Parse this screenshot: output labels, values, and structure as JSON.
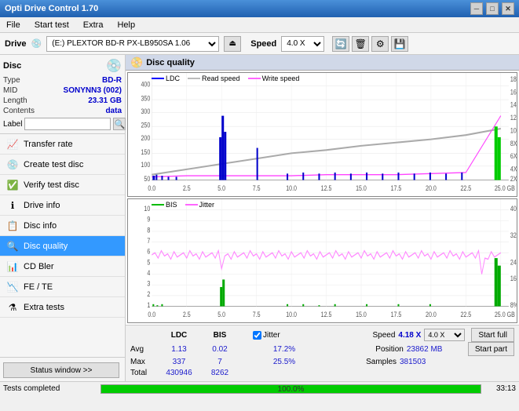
{
  "titleBar": {
    "title": "Opti Drive Control 1.70",
    "minimizeLabel": "─",
    "maximizeLabel": "□",
    "closeLabel": "✕"
  },
  "menuBar": {
    "items": [
      "File",
      "Start test",
      "Extra",
      "Help"
    ]
  },
  "driveBar": {
    "driveLabel": "Drive",
    "driveValue": "(E:) PLEXTOR BD-R  PX-LB950SA 1.06",
    "speedLabel": "Speed",
    "speedValue": "4.0 X"
  },
  "disc": {
    "title": "Disc",
    "typeLabel": "Type",
    "typeValue": "BD-R",
    "midLabel": "MID",
    "midValue": "SONYNN3 (002)",
    "lengthLabel": "Length",
    "lengthValue": "23.31 GB",
    "contentsLabel": "Contents",
    "contentsValue": "data",
    "labelLabel": "Label",
    "labelValue": ""
  },
  "navItems": [
    {
      "id": "transfer-rate",
      "label": "Transfer rate",
      "icon": "📈"
    },
    {
      "id": "create-test-disc",
      "label": "Create test disc",
      "icon": "💿"
    },
    {
      "id": "verify-test-disc",
      "label": "Verify test disc",
      "icon": "✅"
    },
    {
      "id": "drive-info",
      "label": "Drive info",
      "icon": "ℹ"
    },
    {
      "id": "disc-info",
      "label": "Disc info",
      "icon": "📋"
    },
    {
      "id": "disc-quality",
      "label": "Disc quality",
      "icon": "🔍",
      "active": true
    },
    {
      "id": "cd-bler",
      "label": "CD Bler",
      "icon": "📊"
    },
    {
      "id": "fe-te",
      "label": "FE / TE",
      "icon": "📉"
    },
    {
      "id": "extra-tests",
      "label": "Extra tests",
      "icon": "⚗"
    }
  ],
  "discQuality": {
    "title": "Disc quality",
    "icon": "📀"
  },
  "chart1": {
    "legend": [
      {
        "label": "LDC",
        "color": "#0000ff"
      },
      {
        "label": "Read speed",
        "color": "#cccccc"
      },
      {
        "label": "Write speed",
        "color": "#ff66ff"
      }
    ],
    "yAxisRight": [
      "18X",
      "16X",
      "14X",
      "12X",
      "10X",
      "8X",
      "6X",
      "4X",
      "2X"
    ],
    "yAxisLeft": [
      "400",
      "350",
      "300",
      "250",
      "200",
      "150",
      "100",
      "50"
    ],
    "xAxis": [
      "0.0",
      "2.5",
      "5.0",
      "7.5",
      "10.0",
      "12.5",
      "15.0",
      "17.5",
      "20.0",
      "22.5",
      "25.0 GB"
    ]
  },
  "chart2": {
    "legend": [
      {
        "label": "BIS",
        "color": "#00bb00"
      },
      {
        "label": "Jitter",
        "color": "#ff66ff"
      }
    ],
    "yAxisRight": [
      "40%",
      "32%",
      "24%",
      "16%",
      "8%"
    ],
    "yAxisLeft": [
      "10",
      "9",
      "8",
      "7",
      "6",
      "5",
      "4",
      "3",
      "2",
      "1"
    ],
    "xAxis": [
      "0.0",
      "2.5",
      "5.0",
      "7.5",
      "10.0",
      "12.5",
      "15.0",
      "17.5",
      "20.0",
      "22.5",
      "25.0 GB"
    ]
  },
  "stats": {
    "headers": {
      "ldc": "LDC",
      "bis": "BIS",
      "jitter": "Jitter",
      "speed": "Speed",
      "speedVal": "4.18 X",
      "speedSelect": "4.0 X"
    },
    "rows": [
      {
        "label": "Avg",
        "ldc": "1.13",
        "bis": "0.02",
        "jitter": "17.2%",
        "posLabel": "Position",
        "posVal": "23862 MB"
      },
      {
        "label": "Max",
        "ldc": "337",
        "bis": "7",
        "jitter": "25.5%",
        "sampLabel": "Samples",
        "sampVal": "381503"
      },
      {
        "label": "Total",
        "ldc": "430946",
        "bis": "8262",
        "jitter": ""
      }
    ],
    "jitterChecked": true,
    "startFullLabel": "Start full",
    "startPartLabel": "Start part"
  },
  "statusBar": {
    "statusText": "Tests completed",
    "progressPercent": 100,
    "progressLabel": "100.0%",
    "timeLabel": "33:13"
  },
  "statusWindowBtn": "Status window >>"
}
